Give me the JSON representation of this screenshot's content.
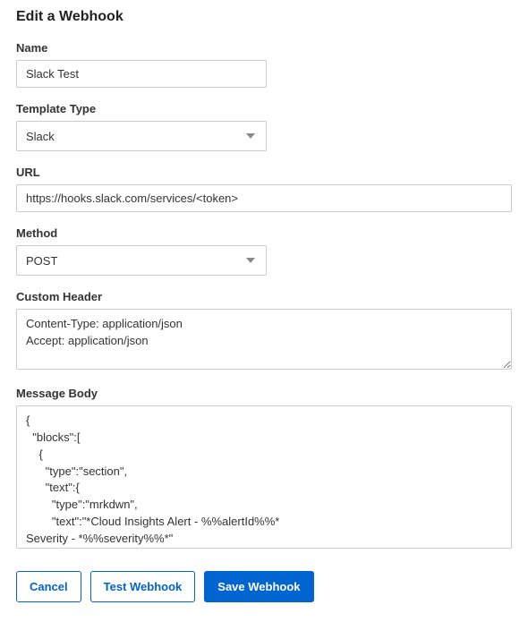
{
  "page": {
    "title": "Edit a Webhook"
  },
  "fields": {
    "name": {
      "label": "Name",
      "value": "Slack Test"
    },
    "template_type": {
      "label": "Template Type",
      "value": "Slack"
    },
    "url": {
      "label": "URL",
      "value": "https://hooks.slack.com/services/<token>"
    },
    "method": {
      "label": "Method",
      "value": "POST"
    },
    "custom_header": {
      "label": "Custom Header",
      "value": "Content-Type: application/json\nAccept: application/json"
    },
    "message_body": {
      "label": "Message Body",
      "value": "{\n  \"blocks\":[\n    {\n      \"type\":\"section\",\n      \"text\":{\n        \"type\":\"mrkdwn\",\n        \"text\":\"*Cloud Insights Alert - %%alertId%%*\nSeverity - *%%severity%%*\"\n      }\n    },\n    {"
    }
  },
  "buttons": {
    "cancel": "Cancel",
    "test": "Test Webhook",
    "save": "Save Webhook"
  }
}
